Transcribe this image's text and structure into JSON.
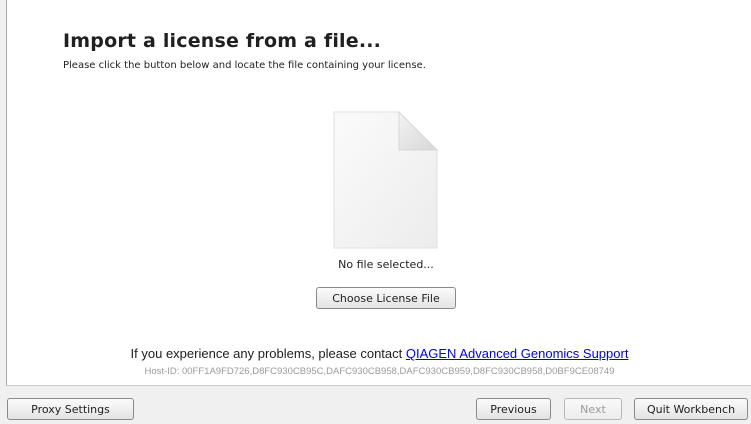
{
  "page": {
    "title": "Import a license from a file...",
    "subtitle": "Please click the button below and locate the file containing your license."
  },
  "file_selection": {
    "icon": "document-icon",
    "status": "No file selected...",
    "choose_button_label": "Choose License File"
  },
  "support": {
    "prefix": "If you experience any problems, please contact ",
    "link_text": "QIAGEN Advanced Genomics Support",
    "host_id": "Host-ID: 00FF1A9FD726,D8FC930CB95C,DAFC930CB958,DAFC930CB959,D8FC930CB958,D0BF9CE08749",
    "link_color": "#0000ee"
  },
  "footer": {
    "proxy_label": "Proxy Settings",
    "previous_label": "Previous",
    "next_label": "Next",
    "next_enabled": false,
    "quit_label": "Quit Workbench"
  }
}
